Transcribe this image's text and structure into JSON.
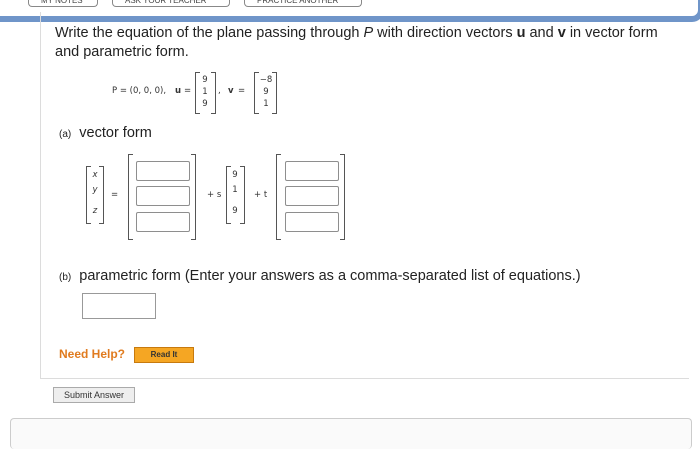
{
  "top_tabs": [
    "MY NOTES",
    "ASK YOUR TEACHER",
    "PRACTICE ANOTHER"
  ],
  "question": {
    "text_before_P": "Write the equation of the plane passing through ",
    "P_symbol": "P",
    "text_after_P": " with direction vectors ",
    "u": "u",
    "and": " and ",
    "v": "v",
    "text_end": " in vector form and parametric form."
  },
  "given": {
    "P_label": "P = (0, 0, 0),",
    "u_label": "u",
    "equals": "=",
    "u_values": [
      "9",
      "1",
      "9"
    ],
    "comma": ",",
    "v_label": "v",
    "v_values": [
      "−8",
      "9",
      "1"
    ]
  },
  "part_a": {
    "letter": "(a)",
    "label": "vector form",
    "xyz": [
      "x",
      "y",
      "z"
    ],
    "plus_s": "+ s",
    "plus_t": "+ t",
    "u_values": [
      "9",
      "1",
      "9"
    ]
  },
  "part_b": {
    "letter": "(b)",
    "label": "parametric form (Enter your answers as a comma-separated list of equations.)"
  },
  "help": {
    "need_help": "Need Help?",
    "read_it": "Read It"
  },
  "submit_label": "Submit Answer"
}
